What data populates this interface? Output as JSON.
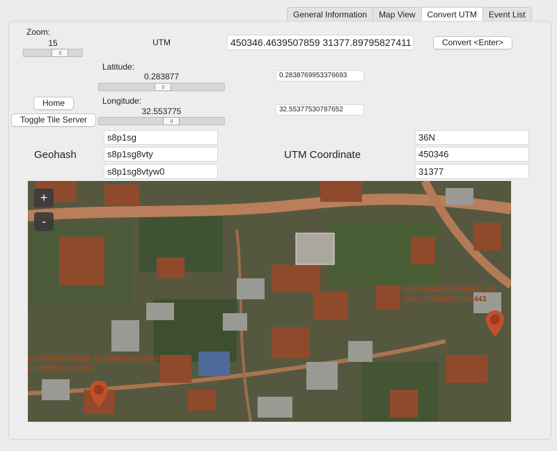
{
  "tabs": [
    {
      "label": "General Information"
    },
    {
      "label": "Map View"
    },
    {
      "label": "Convert UTM",
      "active": true
    },
    {
      "label": "Event List"
    }
  ],
  "zoom": {
    "label": "Zoom:",
    "value": "15",
    "level_fraction": 0.6
  },
  "utm_label": "UTM",
  "utm_input": "450346.4639507859 31377.89795827411",
  "convert_button": "Convert <Enter>",
  "latitude": {
    "label": "Latitude:",
    "value": "0.283877",
    "precise": "0.2838769953376693",
    "level_fraction": 0.5
  },
  "longitude": {
    "label": "Longitude:",
    "value": "32.553775",
    "precise": "32.55377530787652",
    "level_fraction": 0.54
  },
  "home_button": "Home",
  "toggle_button": "Toggle Tile Server",
  "geohash": {
    "label": "Geohash",
    "values": [
      "s8p1sg",
      "s8p1sg8vty",
      "s8p1sg8vtyw0"
    ]
  },
  "utm_coordinate": {
    "label": "UTM Coordinate",
    "values": [
      "36N",
      "450346",
      "31377"
    ]
  },
  "map": {
    "zoom_in": "+",
    "zoom_out": "-",
    "marker_right": {
      "line1": "0.28448853514708289, 32",
      "line2": "36N x=450496 y=31443"
    },
    "marker_left": {
      "line1": "0.2838702365856, 32.55386611360674",
      "line2": "x=450300 y=31313"
    },
    "marker_color": "#c0502a"
  }
}
